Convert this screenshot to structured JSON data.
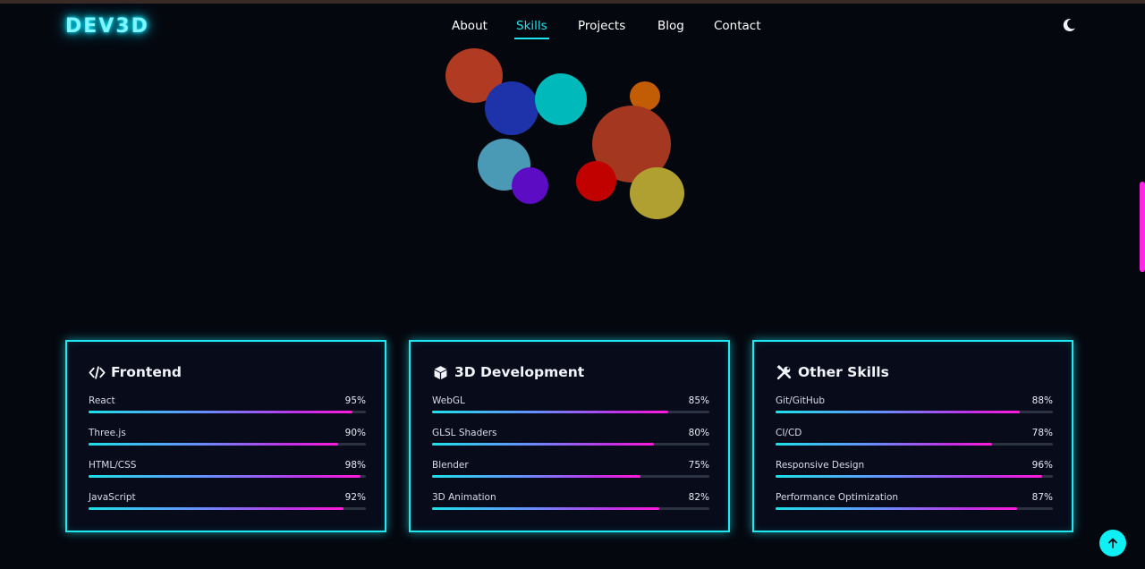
{
  "header": {
    "logo": "DEV3D",
    "nav": [
      {
        "label": "About"
      },
      {
        "label": "Skills",
        "active": true
      },
      {
        "label": "Projects"
      },
      {
        "label": "Blog"
      },
      {
        "label": "Contact"
      }
    ],
    "theme_toggle_icon": "moon-icon"
  },
  "colors": {
    "accent_cyan": "#1fe8f2",
    "accent_magenta": "#ff28e6",
    "background": "#05070f"
  },
  "decorative_circles": [
    {
      "color": "#b03a22"
    },
    {
      "color": "#1e33aa"
    },
    {
      "color": "#00b9bb"
    },
    {
      "color": "#c25d06"
    },
    {
      "color": "#a33720"
    },
    {
      "color": "#4a9ab5"
    },
    {
      "color": "#5c0cc2"
    },
    {
      "color": "#c10000"
    },
    {
      "color": "#b0a031"
    }
  ],
  "skills": [
    {
      "icon": "code-icon",
      "title": "Frontend",
      "items": [
        {
          "name": "React",
          "percent_label": "95%",
          "percent": 95
        },
        {
          "name": "Three.js",
          "percent_label": "90%",
          "percent": 90
        },
        {
          "name": "HTML/CSS",
          "percent_label": "98%",
          "percent": 98
        },
        {
          "name": "JavaScript",
          "percent_label": "92%",
          "percent": 92
        }
      ]
    },
    {
      "icon": "cube-icon",
      "title": "3D Development",
      "items": [
        {
          "name": "WebGL",
          "percent_label": "85%",
          "percent": 85
        },
        {
          "name": "GLSL Shaders",
          "percent_label": "80%",
          "percent": 80
        },
        {
          "name": "Blender",
          "percent_label": "75%",
          "percent": 75
        },
        {
          "name": "3D Animation",
          "percent_label": "82%",
          "percent": 82
        }
      ]
    },
    {
      "icon": "tools-icon",
      "title": "Other Skills",
      "items": [
        {
          "name": "Git/GitHub",
          "percent_label": "88%",
          "percent": 88
        },
        {
          "name": "CI/CD",
          "percent_label": "78%",
          "percent": 78
        },
        {
          "name": "Responsive Design",
          "percent_label": "96%",
          "percent": 96
        },
        {
          "name": "Performance Optimization",
          "percent_label": "87%",
          "percent": 87
        }
      ]
    }
  ],
  "back_to_top_icon": "arrow-up-icon"
}
